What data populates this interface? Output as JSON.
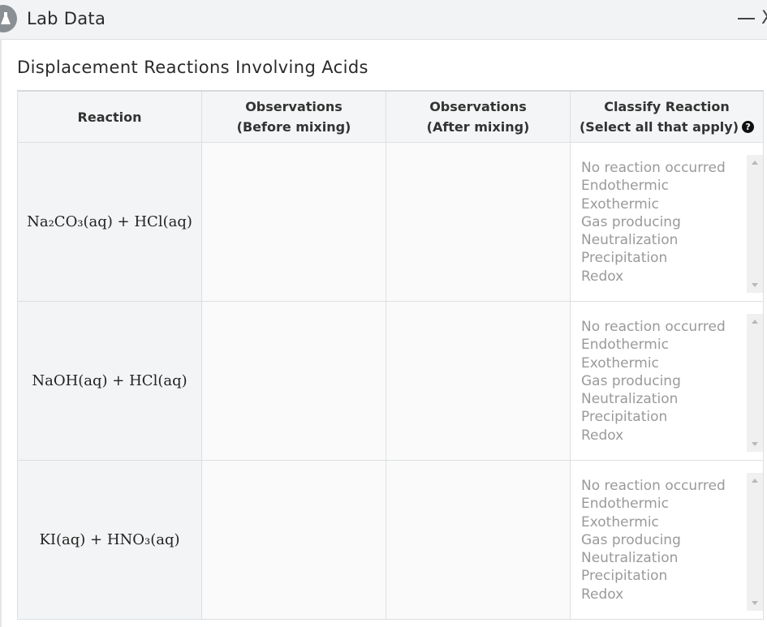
{
  "window": {
    "title": "Lab Data",
    "minimize_icon": "minimize-icon",
    "close_label": "X"
  },
  "page": {
    "heading": "Displacement Reactions Involving Acids"
  },
  "table": {
    "headers": {
      "reaction": "Reaction",
      "obs_before_line1": "Observations",
      "obs_before_line2": "(Before mixing)",
      "obs_after_line1": "Observations",
      "obs_after_line2": "(After mixing)",
      "classify_line1": "Classify Reaction",
      "classify_line2": "(Select all that apply)",
      "help_icon_glyph": "?"
    },
    "rows": [
      {
        "reaction": "Na₂CO₃(aq) + HCl(aq)",
        "obs_before": "",
        "obs_after": "",
        "options": [
          "No reaction occurred",
          "Endothermic",
          "Exothermic",
          "Gas producing",
          "Neutralization",
          "Precipitation",
          "Redox"
        ]
      },
      {
        "reaction": "NaOH(aq) + HCl(aq)",
        "obs_before": "",
        "obs_after": "",
        "options": [
          "No reaction occurred",
          "Endothermic",
          "Exothermic",
          "Gas producing",
          "Neutralization",
          "Precipitation",
          "Redox"
        ]
      },
      {
        "reaction": "KI(aq) + HNO₃(aq)",
        "obs_before": "",
        "obs_after": "",
        "options": [
          "No reaction occurred",
          "Endothermic",
          "Exothermic",
          "Gas producing",
          "Neutralization",
          "Precipitation",
          "Redox"
        ]
      }
    ]
  },
  "colors": {
    "titlebar_bg": "#f2f3f4",
    "header_bg": "#f4f5f6",
    "option_text": "#9a9a9a",
    "border": "#dcdfe2"
  }
}
